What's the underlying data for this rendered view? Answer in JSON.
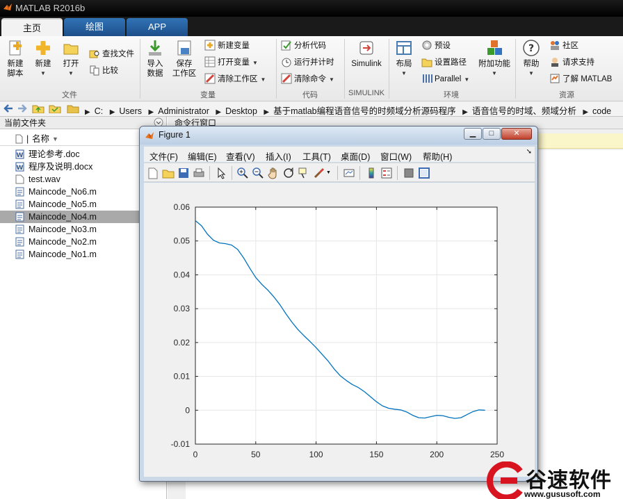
{
  "app": {
    "title": "MATLAB R2016b"
  },
  "tabs": [
    {
      "label": "主页"
    },
    {
      "label": "绘图"
    },
    {
      "label": "APP"
    }
  ],
  "toolstrip": {
    "file": {
      "title": "文件",
      "new_script": "新建\n脚本",
      "new": "新建",
      "open": "打开",
      "find_files": "查找文件",
      "compare": "比较"
    },
    "variable": {
      "title": "变量",
      "import": "导入\n数据",
      "save_ws": "保存\n工作区",
      "new_var": "新建变量",
      "open_var": "打开变量",
      "clear_ws": "清除工作区"
    },
    "code": {
      "title": "代码",
      "analyze": "分析代码",
      "run_time": "运行并计时",
      "clear_cmd": "清除命令"
    },
    "simulink": {
      "title": "SIMULINK",
      "simulink": "Simulink"
    },
    "env": {
      "title": "环境",
      "layout": "布局",
      "prefs": "预设",
      "set_path": "设置路径",
      "parallel": "Parallel",
      "addons": "附加功能"
    },
    "resources": {
      "title": "资源",
      "help": "帮助",
      "community": "社区",
      "support": "请求支持",
      "learn": "了解 MATLAB"
    }
  },
  "address": {
    "path": [
      "C:",
      "Users",
      "Administrator",
      "Desktop",
      "基于matlab编程语音信号的时频域分析源码程序",
      "语音信号的时域、频域分析",
      "code"
    ]
  },
  "folder_panel": {
    "title": "当前文件夹",
    "col_name": "名称",
    "files": [
      {
        "name": "理论参考.doc",
        "icon": "word-doc-icon"
      },
      {
        "name": "程序及说明.docx",
        "icon": "word-doc-icon"
      },
      {
        "name": "test.wav",
        "icon": "audio-file-icon"
      },
      {
        "name": "Maincode_No6.m",
        "icon": "m-file-icon"
      },
      {
        "name": "Maincode_No5.m",
        "icon": "m-file-icon"
      },
      {
        "name": "Maincode_No4.m",
        "icon": "m-file-icon",
        "selected": true
      },
      {
        "name": "Maincode_No3.m",
        "icon": "m-file-icon"
      },
      {
        "name": "Maincode_No2.m",
        "icon": "m-file-icon"
      },
      {
        "name": "Maincode_No1.m",
        "icon": "m-file-icon"
      }
    ]
  },
  "command_panel": {
    "title": "命令行窗口"
  },
  "figure": {
    "title": "Figure 1",
    "menu": [
      "文件(F)",
      "编辑(E)",
      "查看(V)",
      "插入(I)",
      "工具(T)",
      "桌面(D)",
      "窗口(W)",
      "帮助(H)"
    ],
    "win_min": "▁",
    "win_max": "□",
    "win_close": "✕"
  },
  "chart_data": {
    "type": "line",
    "title": "",
    "xlabel": "",
    "ylabel": "",
    "xlim": [
      0,
      250
    ],
    "ylim": [
      -0.01,
      0.06
    ],
    "xticks": [
      "0",
      "50",
      "100",
      "150",
      "200",
      "250"
    ],
    "yticks": [
      "-0.01",
      "0",
      "0.01",
      "0.02",
      "0.03",
      "0.04",
      "0.05",
      "0.06"
    ],
    "grid": true,
    "series": [
      {
        "color": "#0072bd",
        "x": [
          0,
          5,
          10,
          15,
          20,
          25,
          30,
          35,
          40,
          45,
          50,
          55,
          60,
          65,
          70,
          75,
          80,
          85,
          90,
          95,
          100,
          105,
          110,
          115,
          120,
          125,
          130,
          135,
          140,
          145,
          150,
          155,
          160,
          165,
          170,
          175,
          180,
          185,
          190,
          195,
          200,
          205,
          210,
          215,
          220,
          225,
          230,
          235,
          240
        ],
        "y": [
          0.056,
          0.0545,
          0.052,
          0.0502,
          0.0494,
          0.0492,
          0.0488,
          0.0475,
          0.045,
          0.042,
          0.0392,
          0.0372,
          0.0355,
          0.0335,
          0.0312,
          0.0285,
          0.026,
          0.0238,
          0.022,
          0.0203,
          0.0185,
          0.0165,
          0.0145,
          0.0122,
          0.0102,
          0.0088,
          0.0076,
          0.0067,
          0.0055,
          0.004,
          0.0025,
          0.0013,
          0.0006,
          0.0003,
          0.0001,
          -0.0005,
          -0.0015,
          -0.0022,
          -0.0023,
          -0.0019,
          -0.0015,
          -0.0016,
          -0.0021,
          -0.0024,
          -0.0022,
          -0.0013,
          -0.0004,
          0.0001,
          0.0
        ]
      }
    ]
  },
  "watermark": {
    "name": "谷速软件",
    "url": "www.gususoft.com"
  }
}
